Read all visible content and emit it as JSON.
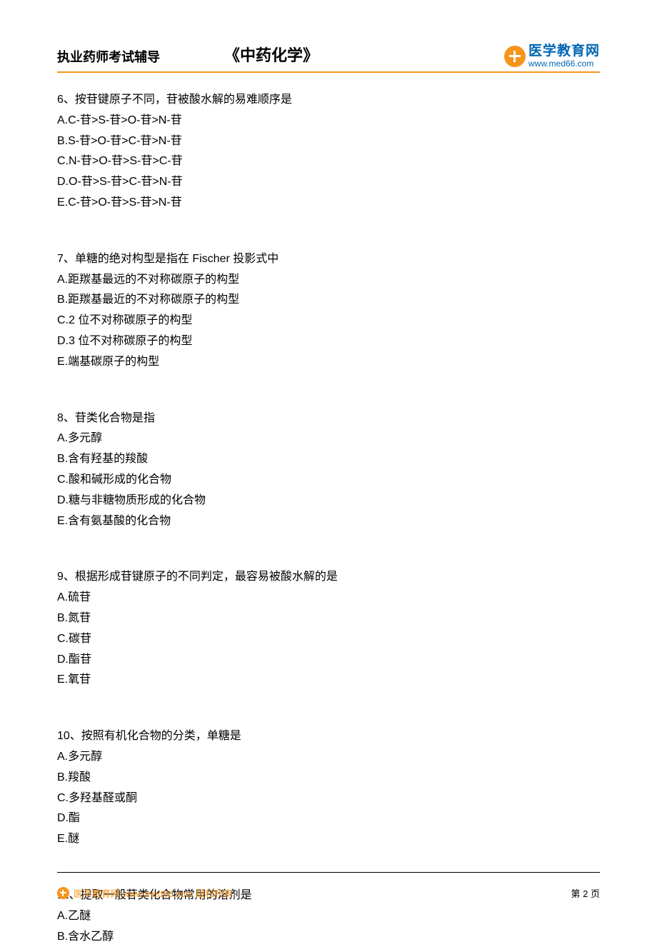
{
  "header": {
    "left": "执业药师考试辅导",
    "title": "《中药化学》",
    "logo_cn": "医学教育网",
    "logo_url": "www.med66.com"
  },
  "questions": [
    {
      "q": "6、按苷键原子不同，苷被酸水解的易难顺序是",
      "opts": [
        "A.C-苷>S-苷>O-苷>N-苷",
        "B.S-苷>O-苷>C-苷>N-苷",
        "C.N-苷>O-苷>S-苷>C-苷",
        "D.O-苷>S-苷>C-苷>N-苷",
        "E.C-苷>O-苷>S-苷>N-苷"
      ]
    },
    {
      "q": "7、单糖的绝对构型是指在 Fischer 投影式中",
      "opts": [
        "A.距羰基最远的不对称碳原子的构型",
        "B.距羰基最近的不对称碳原子的构型",
        "C.2 位不对称碳原子的构型",
        "D.3 位不对称碳原子的构型",
        "E.端基碳原子的构型"
      ]
    },
    {
      "q": "8、苷类化合物是指",
      "opts": [
        "A.多元醇",
        "B.含有羟基的羧酸",
        "C.酸和碱形成的化合物",
        "D.糖与非糖物质形成的化合物",
        "E.含有氨基酸的化合物"
      ]
    },
    {
      "q": "9、根据形成苷键原子的不同判定，最容易被酸水解的是",
      "opts": [
        "A.硫苷",
        "B.氮苷",
        "C.碳苷",
        "D.酯苷",
        "E.氧苷"
      ]
    },
    {
      "q": "10、按照有机化合物的分类，单糖是",
      "opts": [
        "A.多元醇",
        "B.羧酸",
        "C.多羟基醛或酮",
        "D.酯",
        "E.醚"
      ]
    },
    {
      "q": "11、提取一般苷类化合物常用的溶剂是",
      "opts": [
        "A.乙醚",
        "B.含水乙醇"
      ]
    }
  ],
  "footer": {
    "text": "医学教育网 www.med66.com 版权所有",
    "page": "第 2 页"
  }
}
